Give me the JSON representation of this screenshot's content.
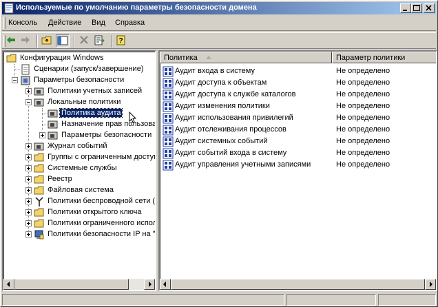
{
  "window": {
    "title": "Используемые по умолчанию параметры безопасности домена"
  },
  "menu": [
    {
      "label": "Консоль"
    },
    {
      "label": "Действие"
    },
    {
      "label": "Вид"
    },
    {
      "label": "Справка"
    }
  ],
  "toolbar": [
    {
      "icon": "back-arrow-icon"
    },
    {
      "icon": "forward-arrow-icon"
    },
    {
      "icon": "up-folder-icon"
    },
    {
      "icon": "show-hide-tree-icon"
    },
    {
      "icon": "delete-icon"
    },
    {
      "icon": "export-list-icon"
    },
    {
      "icon": "help-icon"
    }
  ],
  "tree": {
    "root": "Конфигурация Windows",
    "scripts": "Сценарии (запуск/завершение)",
    "security_settings": "Параметры безопасности",
    "account_policies": "Политики учетных записей",
    "local_policies": "Локальные политики",
    "audit_policy": "Политика аудита",
    "user_rights": "Назначение прав пользоват",
    "security_options": "Параметры безопасности",
    "event_log": "Журнал событий",
    "restricted_groups": "Группы с ограниченным доступ",
    "system_services": "Системные службы",
    "registry": "Реестр",
    "file_system": "Файловая система",
    "wireless": "Политики беспроводной сети (I",
    "public_key": "Политики открытого ключа",
    "software_restriction": "Политики ограниченного испол",
    "ipsec": "Политики безопасности IP на \"("
  },
  "list": {
    "headers": {
      "policy": "Политика",
      "setting": "Параметр политики"
    },
    "rows": [
      {
        "policy": "Аудит входа в систему",
        "setting": "Не определено"
      },
      {
        "policy": "Аудит доступа к объектам",
        "setting": "Не определено"
      },
      {
        "policy": "Аудит доступа к службе каталогов",
        "setting": "Не определено"
      },
      {
        "policy": "Аудит изменения политики",
        "setting": "Не определено"
      },
      {
        "policy": "Аудит использования привилегий",
        "setting": "Не определено"
      },
      {
        "policy": "Аудит отслеживания процессов",
        "setting": "Не определено"
      },
      {
        "policy": "Аудит системных событий",
        "setting": "Не определено"
      },
      {
        "policy": "Аудит событий входа в систему",
        "setting": "Не определено"
      },
      {
        "policy": "Аудит управления учетными записями",
        "setting": "Не определено"
      }
    ]
  },
  "colors": {
    "titlebar_start": "#0a246a",
    "titlebar_end": "#a6caf0",
    "face": "#d4d0c8",
    "selection": "#0a246a"
  }
}
